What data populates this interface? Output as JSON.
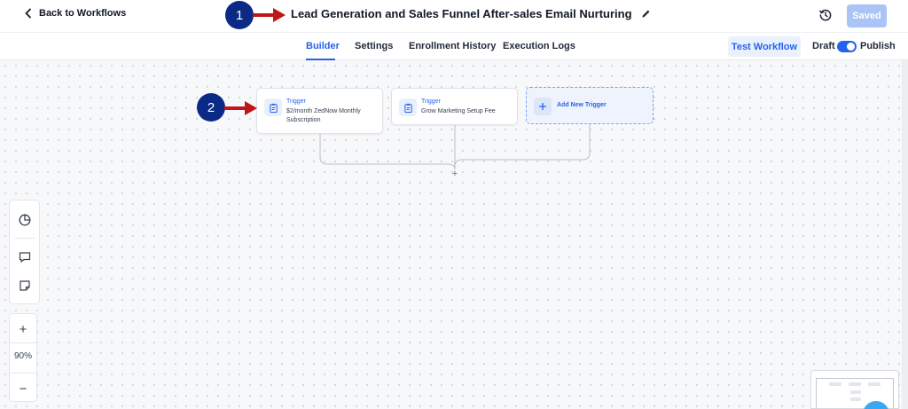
{
  "header": {
    "back_label": "Back to Workflows",
    "title": "Lead Generation and Sales Funnel After-sales Email Nurturing",
    "saved_label": "Saved"
  },
  "tabs": [
    {
      "label": "Builder",
      "active": true
    },
    {
      "label": "Settings",
      "active": false
    },
    {
      "label": "Enrollment History",
      "active": false
    },
    {
      "label": "Execution Logs",
      "active": false
    }
  ],
  "controls": {
    "test_workflow_label": "Test Workflow",
    "draft_label": "Draft",
    "publish_label": "Publish",
    "publish_toggle_on": true
  },
  "triggers": [
    {
      "type": "Trigger",
      "name": "$2/month ZedNow Monthly Subscription"
    },
    {
      "type": "Trigger",
      "name": "Grow Marketing Setup Fee"
    }
  ],
  "add_trigger_label": "Add New Trigger",
  "join_plus": "+",
  "annotations": [
    {
      "number": "1"
    },
    {
      "number": "2"
    }
  ],
  "zoom": {
    "in_label": "+",
    "level": "90%",
    "out_label": "−"
  },
  "colors": {
    "accent": "#2563eb",
    "annotation_badge": "#0b2a86",
    "annotation_arrow": "#c0161a",
    "saved_button": "#a9c4f5"
  },
  "icons": {
    "back": "chevron-left-icon",
    "edit": "pencil-icon",
    "history": "history-icon",
    "trigger": "clipboard-icon",
    "add": "plus-icon",
    "toolbox": [
      "pie-chart-icon",
      "comment-icon",
      "sticky-note-icon"
    ]
  }
}
